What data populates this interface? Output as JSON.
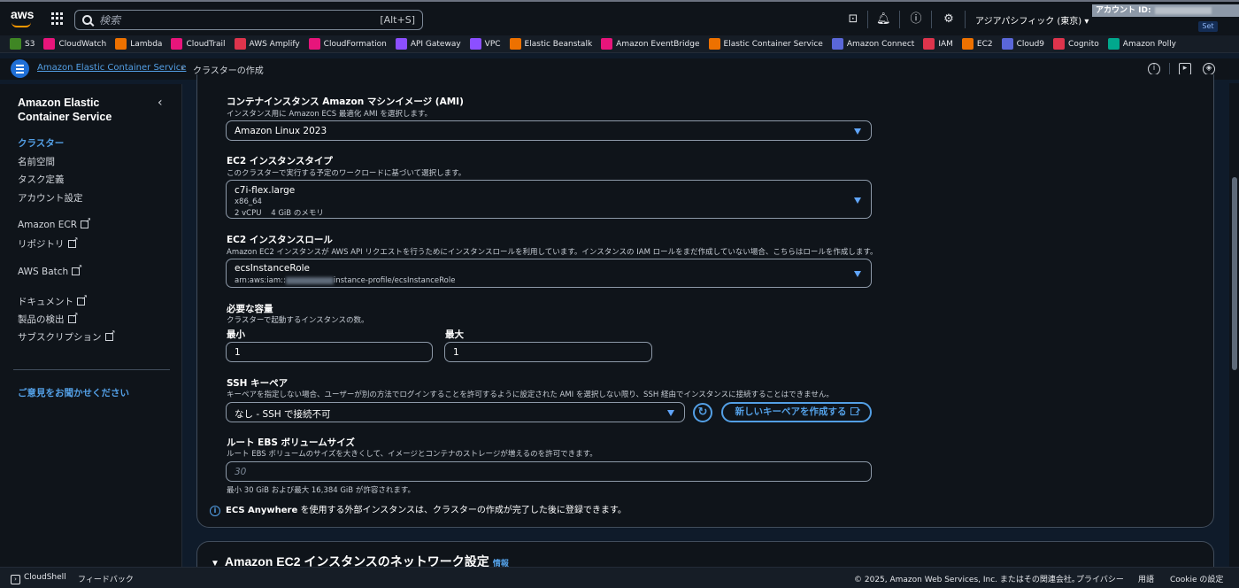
{
  "topbar": {
    "logo_text": "aws",
    "search_placeholder": "検索",
    "search_shortcut": "[Alt+S]",
    "region": "アジアパシフィック (東京) ▾",
    "account_label": "アカウント ID:",
    "account_tab": "Set"
  },
  "favorites": [
    {
      "label": "S3",
      "color": "#3f8624"
    },
    {
      "label": "CloudWatch",
      "color": "#e7157b"
    },
    {
      "label": "Lambda",
      "color": "#ed7100"
    },
    {
      "label": "CloudTrail",
      "color": "#e7157b"
    },
    {
      "label": "AWS Amplify",
      "color": "#dd344c"
    },
    {
      "label": "CloudFormation",
      "color": "#e7157b"
    },
    {
      "label": "API Gateway",
      "color": "#8c4fff"
    },
    {
      "label": "VPC",
      "color": "#8c4fff"
    },
    {
      "label": "Elastic Beanstalk",
      "color": "#ed7100"
    },
    {
      "label": "Amazon EventBridge",
      "color": "#e7157b"
    },
    {
      "label": "Elastic Container Service",
      "color": "#ed7100"
    },
    {
      "label": "Amazon Connect",
      "color": "#5a67d8"
    },
    {
      "label": "IAM",
      "color": "#dd344c"
    },
    {
      "label": "EC2",
      "color": "#ed7100"
    },
    {
      "label": "Cloud9",
      "color": "#5a67d8"
    },
    {
      "label": "Cognito",
      "color": "#dd344c"
    },
    {
      "label": "Amazon Polly",
      "color": "#01a88d"
    }
  ],
  "breadcrumb": {
    "service": "Amazon Elastic Container Service",
    "separator": "›",
    "current": "クラスターの作成"
  },
  "sidebar": {
    "title": "Amazon Elastic Container Service",
    "items": [
      {
        "label": "クラスター"
      },
      {
        "label": "名前空間"
      },
      {
        "label": "タスク定義"
      },
      {
        "label": "アカウント設定"
      },
      {
        "label": "Amazon ECR"
      },
      {
        "label": "リポジトリ"
      },
      {
        "label": "AWS Batch"
      },
      {
        "label": "ドキュメント"
      },
      {
        "label": "製品の検出"
      },
      {
        "label": "サブスクリプション"
      }
    ],
    "feedback": "ご意見をお聞かせください"
  },
  "form": {
    "ami": {
      "label": "コンテナインスタンス Amazon マシンイメージ (AMI)",
      "desc": "インスタンス用に Amazon ECS 最適化 AMI を選択します。",
      "value": "Amazon Linux 2023"
    },
    "instance_type": {
      "label": "EC2 インスタンスタイプ",
      "desc": "このクラスターで実行する予定のワークロードに基づいて選択します。",
      "value": "c7i-flex.large",
      "arch": "x86_64",
      "specs": "2 vCPU    4 GiB のメモリ"
    },
    "instance_role": {
      "label": "EC2 インスタンスロール",
      "desc": "Amazon EC2 インスタンスが AWS API リクエストを行うためにインスタンスロールを利用しています。インスタンスの IAM ロールをまだ作成していない場合、こちらはロールを作成します。",
      "value": "ecsInstanceRole",
      "arn_prefix": "arn:aws:iam::",
      "arn_suffix": "instance-profile/ecsInstanceRole"
    },
    "capacity": {
      "label": "必要な容量",
      "desc": "クラスターで起動するインスタンスの数。",
      "min_label": "最小",
      "min_value": "1",
      "max_label": "最大",
      "max_value": "1"
    },
    "ssh": {
      "label": "SSH キーペア",
      "desc": "キーペアを指定しない場合、ユーザーが別の方法でログインすることを許可するように設定された AMI を選択しない限り、SSH 経由でインスタンスに接続することはできません。",
      "value": "なし - SSH で接続不可",
      "new_key_button": "新しいキーペアを作成する"
    },
    "ebs": {
      "label": "ルート EBS ボリュームサイズ",
      "desc": "ルート EBS ボリュームのサイズを大きくして、イメージとコンテナのストレージが増えるのを許可できます。",
      "placeholder": "30",
      "constraint": "最小 30 GiB および最大 16,384 GiB が許容されます。"
    },
    "info_bold": "ECS Anywhere",
    "info_rest": " を使用する外部インスタンスは、クラスターの作成が完了した後に登録できます。"
  },
  "network_section": {
    "title": "Amazon EC2 インスタンスのネットワーク設定",
    "info": "情報"
  },
  "footer": {
    "cloudshell": "CloudShell",
    "feedback": "フィードバック",
    "copyright": "© 2025, Amazon Web Services, Inc. またはその関連会社。",
    "privacy": "プライバシー",
    "terms": "用語",
    "cookie": "Cookie の設定"
  }
}
